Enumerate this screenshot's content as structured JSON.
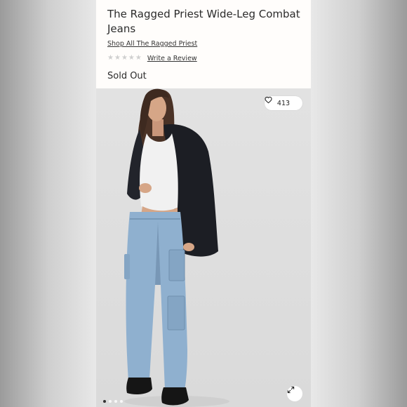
{
  "product": {
    "title": "The Ragged Priest Wide-Leg Combat Jeans",
    "brand_link": "Shop All The Ragged Priest",
    "rating_stars": 5,
    "rating_filled": 0,
    "review_link": "Write a Review",
    "availability": "Sold Out"
  },
  "gallery": {
    "like_count": "413",
    "like_icon": "heart-outline-icon",
    "expand_icon": "expand-arrows-icon",
    "image_count": 4,
    "active_image": 1,
    "image_description_icon": "product-photo"
  },
  "colors": {
    "text": "#2b2b2b",
    "star_empty": "#cfcfcf",
    "denim": "#8fb0cf",
    "blazer": "#1c1e24"
  }
}
